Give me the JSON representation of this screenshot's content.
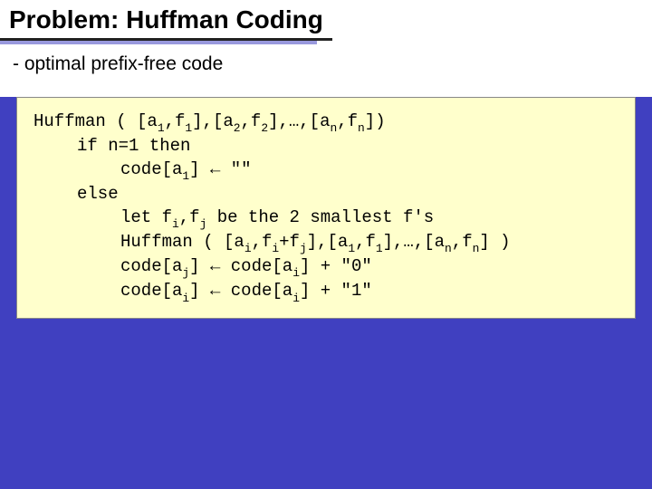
{
  "slide": {
    "title": "Problem: Huffman Coding",
    "subtitle": "- optimal prefix-free code"
  },
  "code": {
    "l1a": "Huffman ( [a",
    "l1b": ",f",
    "l1c": "],[a",
    "l1d": ",f",
    "l1e": "],…,[a",
    "l1f": ",f",
    "l1g": "])",
    "s1": "1",
    "s2": "2",
    "sn": "n",
    "l2": "if n=1 then",
    "l3a": "code[a",
    "l3b": "] ← \"\"",
    "l4": "else",
    "l5a": "let f",
    "l5b": ",f",
    "l5c": " be the 2 smallest f's",
    "si": "i",
    "sj": "j",
    "l6a": "Huffman ( [a",
    "l6b": ",f",
    "l6c": "+f",
    "l6d": "],[a",
    "l6e": ",f",
    "l6f": "],…,[a",
    "l6g": ",f",
    "l6h": "] )",
    "l7a": "code[a",
    "l7b": "] ← code[a",
    "l7c": "] + \"0\"",
    "l8a": "code[a",
    "l8b": "] ← code[a",
    "l8c": "] + \"1\""
  }
}
